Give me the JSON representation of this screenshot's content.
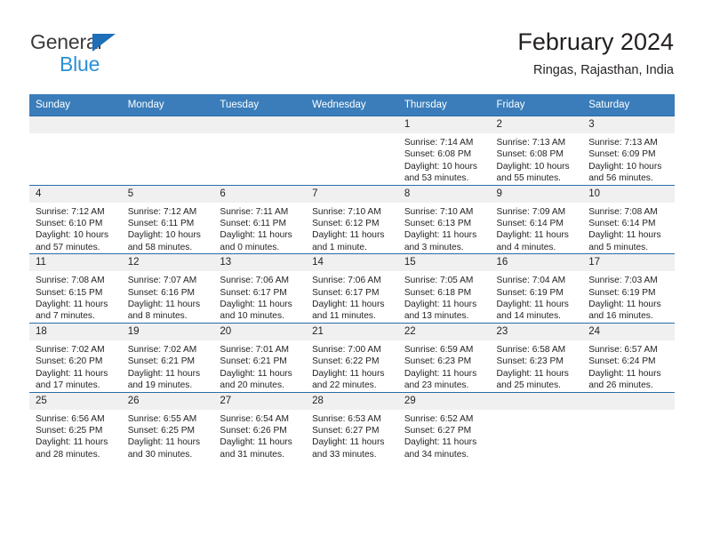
{
  "brand": {
    "line1": "General",
    "line2": "Blue",
    "accent_color": "#1e6eb8",
    "accent_color_light": "#2b8fd6"
  },
  "header": {
    "title": "February 2024",
    "location": "Ringas, Rajasthan, India"
  },
  "theme": {
    "header_band": "#3a7dba",
    "row_rule": "#2b6ca8",
    "daynum_band": "#f0f0f0",
    "text": "#231f20",
    "page_background": "#ffffff"
  },
  "weekday_headers": [
    "Sunday",
    "Monday",
    "Tuesday",
    "Wednesday",
    "Thursday",
    "Friday",
    "Saturday"
  ],
  "weeks": [
    [
      {
        "day": "",
        "info": "",
        "blank": true
      },
      {
        "day": "",
        "info": "",
        "blank": true
      },
      {
        "day": "",
        "info": "",
        "blank": true
      },
      {
        "day": "",
        "info": "",
        "blank": true
      },
      {
        "day": "1",
        "info": "Sunrise: 7:14 AM\nSunset: 6:08 PM\nDaylight: 10 hours\nand 53 minutes."
      },
      {
        "day": "2",
        "info": "Sunrise: 7:13 AM\nSunset: 6:08 PM\nDaylight: 10 hours\nand 55 minutes."
      },
      {
        "day": "3",
        "info": "Sunrise: 7:13 AM\nSunset: 6:09 PM\nDaylight: 10 hours\nand 56 minutes."
      }
    ],
    [
      {
        "day": "4",
        "info": "Sunrise: 7:12 AM\nSunset: 6:10 PM\nDaylight: 10 hours\nand 57 minutes."
      },
      {
        "day": "5",
        "info": "Sunrise: 7:12 AM\nSunset: 6:11 PM\nDaylight: 10 hours\nand 58 minutes."
      },
      {
        "day": "6",
        "info": "Sunrise: 7:11 AM\nSunset: 6:11 PM\nDaylight: 11 hours\nand 0 minutes."
      },
      {
        "day": "7",
        "info": "Sunrise: 7:10 AM\nSunset: 6:12 PM\nDaylight: 11 hours\nand 1 minute."
      },
      {
        "day": "8",
        "info": "Sunrise: 7:10 AM\nSunset: 6:13 PM\nDaylight: 11 hours\nand 3 minutes."
      },
      {
        "day": "9",
        "info": "Sunrise: 7:09 AM\nSunset: 6:14 PM\nDaylight: 11 hours\nand 4 minutes."
      },
      {
        "day": "10",
        "info": "Sunrise: 7:08 AM\nSunset: 6:14 PM\nDaylight: 11 hours\nand 5 minutes."
      }
    ],
    [
      {
        "day": "11",
        "info": "Sunrise: 7:08 AM\nSunset: 6:15 PM\nDaylight: 11 hours\nand 7 minutes."
      },
      {
        "day": "12",
        "info": "Sunrise: 7:07 AM\nSunset: 6:16 PM\nDaylight: 11 hours\nand 8 minutes."
      },
      {
        "day": "13",
        "info": "Sunrise: 7:06 AM\nSunset: 6:17 PM\nDaylight: 11 hours\nand 10 minutes."
      },
      {
        "day": "14",
        "info": "Sunrise: 7:06 AM\nSunset: 6:17 PM\nDaylight: 11 hours\nand 11 minutes."
      },
      {
        "day": "15",
        "info": "Sunrise: 7:05 AM\nSunset: 6:18 PM\nDaylight: 11 hours\nand 13 minutes."
      },
      {
        "day": "16",
        "info": "Sunrise: 7:04 AM\nSunset: 6:19 PM\nDaylight: 11 hours\nand 14 minutes."
      },
      {
        "day": "17",
        "info": "Sunrise: 7:03 AM\nSunset: 6:19 PM\nDaylight: 11 hours\nand 16 minutes."
      }
    ],
    [
      {
        "day": "18",
        "info": "Sunrise: 7:02 AM\nSunset: 6:20 PM\nDaylight: 11 hours\nand 17 minutes."
      },
      {
        "day": "19",
        "info": "Sunrise: 7:02 AM\nSunset: 6:21 PM\nDaylight: 11 hours\nand 19 minutes."
      },
      {
        "day": "20",
        "info": "Sunrise: 7:01 AM\nSunset: 6:21 PM\nDaylight: 11 hours\nand 20 minutes."
      },
      {
        "day": "21",
        "info": "Sunrise: 7:00 AM\nSunset: 6:22 PM\nDaylight: 11 hours\nand 22 minutes."
      },
      {
        "day": "22",
        "info": "Sunrise: 6:59 AM\nSunset: 6:23 PM\nDaylight: 11 hours\nand 23 minutes."
      },
      {
        "day": "23",
        "info": "Sunrise: 6:58 AM\nSunset: 6:23 PM\nDaylight: 11 hours\nand 25 minutes."
      },
      {
        "day": "24",
        "info": "Sunrise: 6:57 AM\nSunset: 6:24 PM\nDaylight: 11 hours\nand 26 minutes."
      }
    ],
    [
      {
        "day": "25",
        "info": "Sunrise: 6:56 AM\nSunset: 6:25 PM\nDaylight: 11 hours\nand 28 minutes."
      },
      {
        "day": "26",
        "info": "Sunrise: 6:55 AM\nSunset: 6:25 PM\nDaylight: 11 hours\nand 30 minutes."
      },
      {
        "day": "27",
        "info": "Sunrise: 6:54 AM\nSunset: 6:26 PM\nDaylight: 11 hours\nand 31 minutes."
      },
      {
        "day": "28",
        "info": "Sunrise: 6:53 AM\nSunset: 6:27 PM\nDaylight: 11 hours\nand 33 minutes."
      },
      {
        "day": "29",
        "info": "Sunrise: 6:52 AM\nSunset: 6:27 PM\nDaylight: 11 hours\nand 34 minutes."
      },
      {
        "day": "",
        "info": "",
        "blank": true
      },
      {
        "day": "",
        "info": "",
        "blank": true
      }
    ]
  ]
}
